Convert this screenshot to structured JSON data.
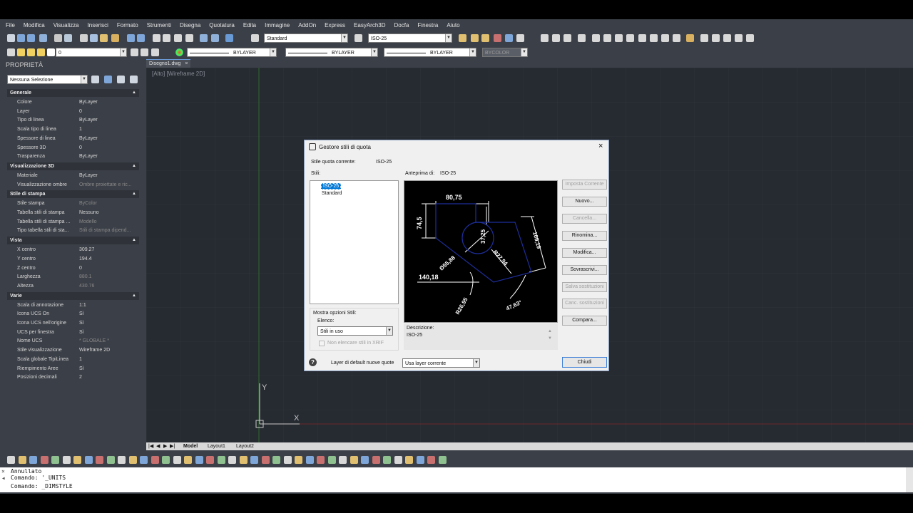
{
  "menu": [
    "File",
    "Modifica",
    "Visualizza",
    "Inserisci",
    "Formato",
    "Strumenti",
    "Disegna",
    "Quotatura",
    "Edita",
    "Immagine",
    "AddOn",
    "Express",
    "EasyArch3D",
    "Docfa",
    "Finestra",
    "Aiuto"
  ],
  "toolbar": {
    "text_style": "Standard",
    "dim_style": "ISO-25",
    "layer": "0",
    "linetype_color": "BYLAYER",
    "linetype": "BYLAYER",
    "lineweight": "BYLAYER",
    "plotstyle": "BYCOLOR"
  },
  "properties": {
    "title": "PROPRIETÀ",
    "selection": "Nessuna Selezione",
    "sections": [
      {
        "name": "Generale",
        "rows": [
          {
            "k": "Colore",
            "v": "ByLayer"
          },
          {
            "k": "Layer",
            "v": "0"
          },
          {
            "k": "Tipo di linea",
            "v": "ByLayer"
          },
          {
            "k": "Scala tipo di linea",
            "v": "1"
          },
          {
            "k": "Spessore di linea",
            "v": "ByLayer"
          },
          {
            "k": "Spessore 3D",
            "v": "0"
          },
          {
            "k": "Trasparenza",
            "v": "ByLayer"
          }
        ]
      },
      {
        "name": "Visualizzazione 3D",
        "rows": [
          {
            "k": "Materiale",
            "v": "ByLayer"
          },
          {
            "k": "Visualizzazione ombre",
            "v": "Ombre proiettate e ric..."
          }
        ]
      },
      {
        "name": "Stile di stampa",
        "rows": [
          {
            "k": "Stile stampa",
            "v": "ByColor"
          },
          {
            "k": "Tabella stili di stampa",
            "v": "Nessuno"
          },
          {
            "k": "Tabella stili di stampa ...",
            "v": "Modello"
          },
          {
            "k": "Tipo tabella stili di sta...",
            "v": "Stili di stampa dipend..."
          }
        ]
      },
      {
        "name": "Vista",
        "rows": [
          {
            "k": "X centro",
            "v": "309.27"
          },
          {
            "k": "Y centro",
            "v": "194.4"
          },
          {
            "k": "Z centro",
            "v": "0"
          },
          {
            "k": "Larghezza",
            "v": "880.1"
          },
          {
            "k": "Altezza",
            "v": "430.76"
          }
        ]
      },
      {
        "name": "Varie",
        "rows": [
          {
            "k": "Scala di annotazione",
            "v": "1:1"
          },
          {
            "k": "Icona UCS On",
            "v": "Sì"
          },
          {
            "k": "Icona UCS nell'origine",
            "v": "Sì"
          },
          {
            "k": "UCS per finestra",
            "v": "Sì"
          },
          {
            "k": "Nome UCS",
            "v": "* GLOBALE *"
          },
          {
            "k": "Stile visualizzazione",
            "v": "Wireframe 2D"
          },
          {
            "k": "Scala globale TipiLinea",
            "v": "1"
          },
          {
            "k": "Riempimento Aree",
            "v": "Sì"
          },
          {
            "k": "Posizioni decimali",
            "v": "2"
          }
        ]
      }
    ]
  },
  "doc_tab": "Disegno1.dwg",
  "doc_tab_close": "×",
  "viewport_label": "[Alto] [Wireframe 2D]",
  "ucs": {
    "y": "Y",
    "x": "X"
  },
  "layout_tabs": [
    "Model",
    "Layout1",
    "Layout2"
  ],
  "command": {
    "lines": [
      "Annullato",
      "Comando: '_UNITS",
      "Comando: _DIMSTYLE"
    ]
  },
  "dialog": {
    "title": "Gestore stili di quota",
    "close": "×",
    "current_label": "Stile quota corrente:",
    "current_value": "ISO-25",
    "styles_label": "Stili:",
    "styles": [
      "ISO-25",
      "Standard"
    ],
    "preview_label": "Anteprima di:",
    "preview_value": "ISO-25",
    "show_options_label": "Mostra opzioni Stili:",
    "list_label": "Elenco:",
    "list_value": "Stili in uso",
    "xref_checkbox": "Non elencare stili in XRIF",
    "description_label": "Descrizione:",
    "description_value": "ISO-25",
    "default_layer_label": "Layer di default nuove quote",
    "default_layer_value": "Usa layer corrente",
    "help": "?",
    "buttons": [
      {
        "label": "Imposta Corrente",
        "enabled": false
      },
      {
        "label": "Nuovo...",
        "enabled": true
      },
      {
        "label": "Cancella...",
        "enabled": false
      },
      {
        "label": "Rinomina...",
        "enabled": true
      },
      {
        "label": "Modifica...",
        "enabled": true
      },
      {
        "label": "Sovrascrivi...",
        "enabled": true
      },
      {
        "label": "Salva sostituzioni",
        "enabled": false
      },
      {
        "label": "Canc. sostituzioni",
        "enabled": false
      },
      {
        "label": "Compara...",
        "enabled": true
      }
    ],
    "close_button": "Chiudi",
    "preview_dims": {
      "top": "80,75",
      "left": "74,5",
      "center": "37,25",
      "right": "109,19",
      "diam": "Ø55,88",
      "radius": "R27,94",
      "horizontal": "140,18",
      "arc_left": "R26,95",
      "arc_right": "47,63°"
    }
  }
}
